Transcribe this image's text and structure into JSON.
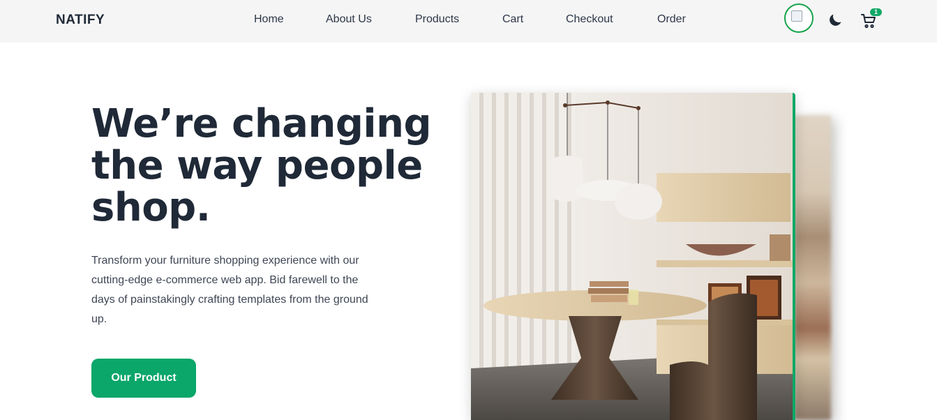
{
  "navbar": {
    "brand": "NATIFY",
    "links": [
      "Home",
      "About Us",
      "Products",
      "Cart",
      "Checkout",
      "Order"
    ],
    "cart_count": "1"
  },
  "hero": {
    "title": "We’re changing the way people shop.",
    "description": "Transform your furniture shopping experience with our cutting-edge e-commerce web app. Bid farewell to the days of painstakingly crafting templates from the ground up.",
    "cta_label": "Our Product"
  },
  "colors": {
    "accent": "#10a866",
    "text_dark": "#1f2937",
    "navbar_bg": "#f5f5f5"
  },
  "icons": [
    "avatar-broken-image-icon",
    "moon-icon",
    "cart-icon"
  ]
}
